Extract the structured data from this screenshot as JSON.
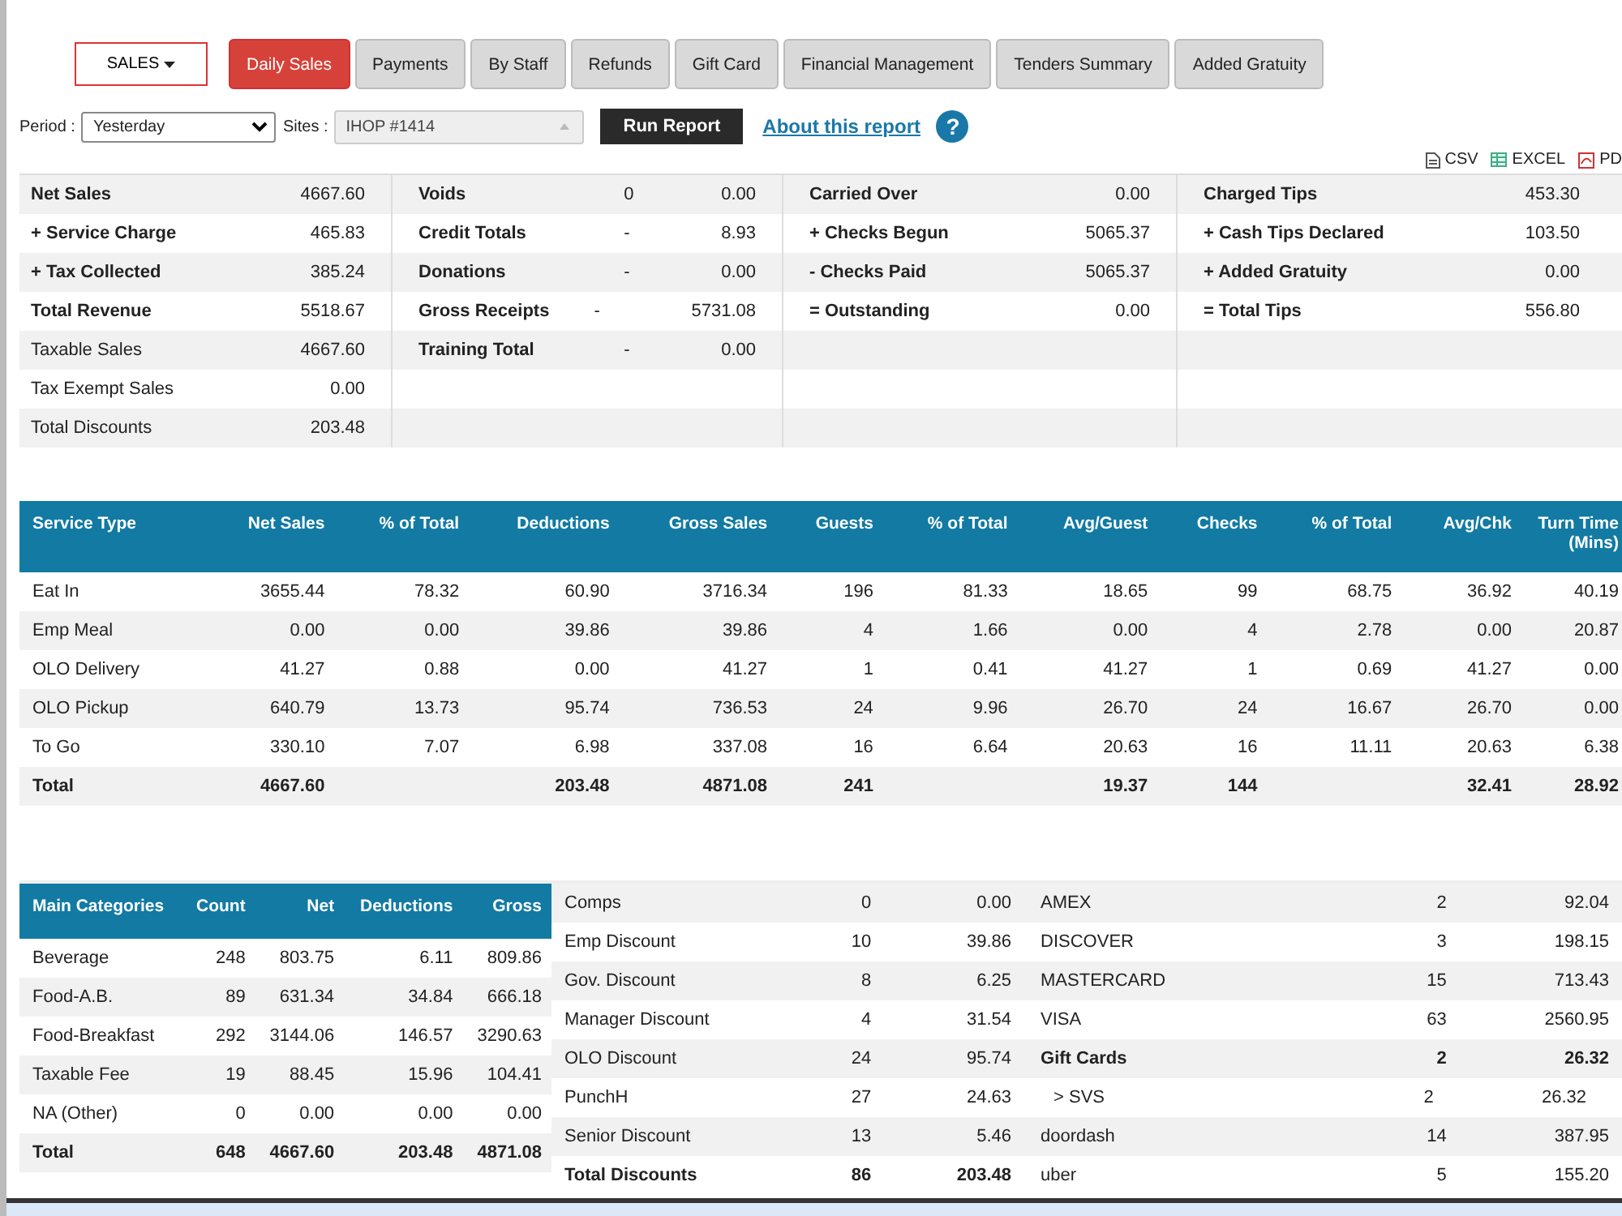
{
  "menu": {
    "label": "SALES"
  },
  "tabs": [
    {
      "label": "Daily Sales",
      "selected": true
    },
    {
      "label": "Payments",
      "selected": false
    },
    {
      "label": "By Staff",
      "selected": false
    },
    {
      "label": "Refunds",
      "selected": false
    },
    {
      "label": "Gift Card",
      "selected": false
    },
    {
      "label": "Financial Management",
      "selected": false
    },
    {
      "label": "Tenders Summary",
      "selected": false
    },
    {
      "label": "Added Gratuity",
      "selected": false
    }
  ],
  "filters": {
    "period_label": "Period :",
    "period": "Yesterday",
    "sites_label": "Sites :",
    "site": "IHOP #1414",
    "run_button": "Run Report",
    "about_link": "About this report",
    "help": "?"
  },
  "exports": [
    {
      "label": "CSV",
      "kind": "csv"
    },
    {
      "label": "EXCEL",
      "kind": "excel"
    },
    {
      "label": "PD",
      "kind": "pdf"
    }
  ],
  "summary": [
    [
      {
        "label": "Net Sales",
        "value": "4667.60",
        "bold": true
      },
      {
        "label": "+ Service Charge",
        "value": "465.83",
        "bold": true
      },
      {
        "label": "+ Tax Collected",
        "value": "385.24",
        "bold": true
      },
      {
        "label": "Total Revenue",
        "value": "5518.67",
        "bold": true
      },
      {
        "label": "Taxable Sales",
        "value": "4667.60",
        "bold": false
      },
      {
        "label": "Tax Exempt Sales",
        "value": "0.00",
        "bold": false
      },
      {
        "label": "Total Discounts",
        "value": "203.48",
        "bold": false
      }
    ],
    [
      {
        "label": "Voids",
        "count": "0",
        "value": "0.00",
        "bold": true
      },
      {
        "label": "Credit Totals",
        "count": "-",
        "value": "8.93",
        "bold": true
      },
      {
        "label": "Donations",
        "count": "-",
        "value": "0.00",
        "bold": true
      },
      {
        "label": "Gross Receipts",
        "count": "-",
        "value": "5731.08",
        "bold": true
      },
      {
        "label": "Training Total",
        "count": "-",
        "value": "0.00",
        "bold": true
      }
    ],
    [
      {
        "label": "Carried Over",
        "value": "0.00",
        "bold": true
      },
      {
        "label": "+ Checks Begun",
        "value": "5065.37",
        "bold": true
      },
      {
        "label": "- Checks Paid",
        "value": "5065.37",
        "bold": true
      },
      {
        "label": "= Outstanding",
        "value": "0.00",
        "bold": true
      }
    ],
    [
      {
        "label": "Charged Tips",
        "value": "453.30",
        "bold": true
      },
      {
        "label": "+ Cash Tips Declared",
        "value": "103.50",
        "bold": true
      },
      {
        "label": "+ Added Gratuity",
        "value": "0.00",
        "bold": true
      },
      {
        "label": "= Total Tips",
        "value": "556.80",
        "bold": true
      }
    ]
  ],
  "service_table": {
    "columns": [
      "Service Type",
      "Net Sales",
      "% of Total",
      "Deductions",
      "Gross Sales",
      "Guests",
      "% of Total",
      "Avg/Guest",
      "Checks",
      "% of Total",
      "Avg/Chk",
      "Turn Time (Mins)"
    ],
    "rows": [
      [
        "Eat In",
        "3655.44",
        "78.32",
        "60.90",
        "3716.34",
        "196",
        "81.33",
        "18.65",
        "99",
        "68.75",
        "36.92",
        "40.19"
      ],
      [
        "Emp Meal",
        "0.00",
        "0.00",
        "39.86",
        "39.86",
        "4",
        "1.66",
        "0.00",
        "4",
        "2.78",
        "0.00",
        "20.87"
      ],
      [
        "OLO Delivery",
        "41.27",
        "0.88",
        "0.00",
        "41.27",
        "1",
        "0.41",
        "41.27",
        "1",
        "0.69",
        "41.27",
        "0.00"
      ],
      [
        "OLO Pickup",
        "640.79",
        "13.73",
        "95.74",
        "736.53",
        "24",
        "9.96",
        "26.70",
        "24",
        "16.67",
        "26.70",
        "0.00"
      ],
      [
        "To Go",
        "330.10",
        "7.07",
        "6.98",
        "337.08",
        "16",
        "6.64",
        "20.63",
        "16",
        "11.11",
        "20.63",
        "6.38"
      ]
    ],
    "total": {
      "service_type": "Total",
      "net_sales": "4667.60",
      "deductions": "203.48",
      "gross_sales": "4871.08",
      "guests": "241",
      "avg_guest": "19.37",
      "checks": "144",
      "avg_chk": "32.41",
      "turn_time": "28.92"
    }
  },
  "category_table": {
    "columns": [
      "Main Categories",
      "Count",
      "Net",
      "Deductions",
      "Gross"
    ],
    "rows": [
      [
        "Beverage",
        "248",
        "803.75",
        "6.11",
        "809.86"
      ],
      [
        "Food-A.B.",
        "89",
        "631.34",
        "34.84",
        "666.18"
      ],
      [
        "Food-Breakfast",
        "292",
        "3144.06",
        "146.57",
        "3290.63"
      ],
      [
        "Taxable Fee",
        "19",
        "88.45",
        "15.96",
        "104.41"
      ],
      [
        "NA (Other)",
        "0",
        "0.00",
        "0.00",
        "0.00"
      ]
    ],
    "total": [
      "Total",
      "648",
      "4667.60",
      "203.48",
      "4871.08"
    ]
  },
  "discounts": [
    {
      "name": "Comps",
      "count": "0",
      "amount": "0.00",
      "bold": false
    },
    {
      "name": "Emp Discount",
      "count": "10",
      "amount": "39.86",
      "bold": false
    },
    {
      "name": "Gov. Discount",
      "count": "8",
      "amount": "6.25",
      "bold": false
    },
    {
      "name": "Manager Discount",
      "count": "4",
      "amount": "31.54",
      "bold": false
    },
    {
      "name": "OLO Discount",
      "count": "24",
      "amount": "95.74",
      "bold": false
    },
    {
      "name": "PunchH",
      "count": "27",
      "amount": "24.63",
      "bold": false
    },
    {
      "name": "Senior Discount",
      "count": "13",
      "amount": "5.46",
      "bold": false
    },
    {
      "name": "Total Discounts",
      "count": "86",
      "amount": "203.48",
      "bold": true
    }
  ],
  "payments": [
    {
      "name": "AMEX",
      "count": "2",
      "amount": "92.04",
      "kind": "item"
    },
    {
      "name": "DISCOVER",
      "count": "3",
      "amount": "198.15",
      "kind": "item"
    },
    {
      "name": "MASTERCARD",
      "count": "15",
      "amount": "713.43",
      "kind": "item"
    },
    {
      "name": "VISA",
      "count": "63",
      "amount": "2560.95",
      "kind": "item"
    },
    {
      "name": "Gift Cards",
      "count": "2",
      "amount": "26.32",
      "kind": "group"
    },
    {
      "name": "> SVS",
      "count": "2",
      "amount": "26.32",
      "kind": "sub"
    },
    {
      "name": "doordash",
      "count": "14",
      "amount": "387.95",
      "kind": "item"
    },
    {
      "name": "uber",
      "count": "5",
      "amount": "155.20",
      "kind": "item"
    }
  ]
}
